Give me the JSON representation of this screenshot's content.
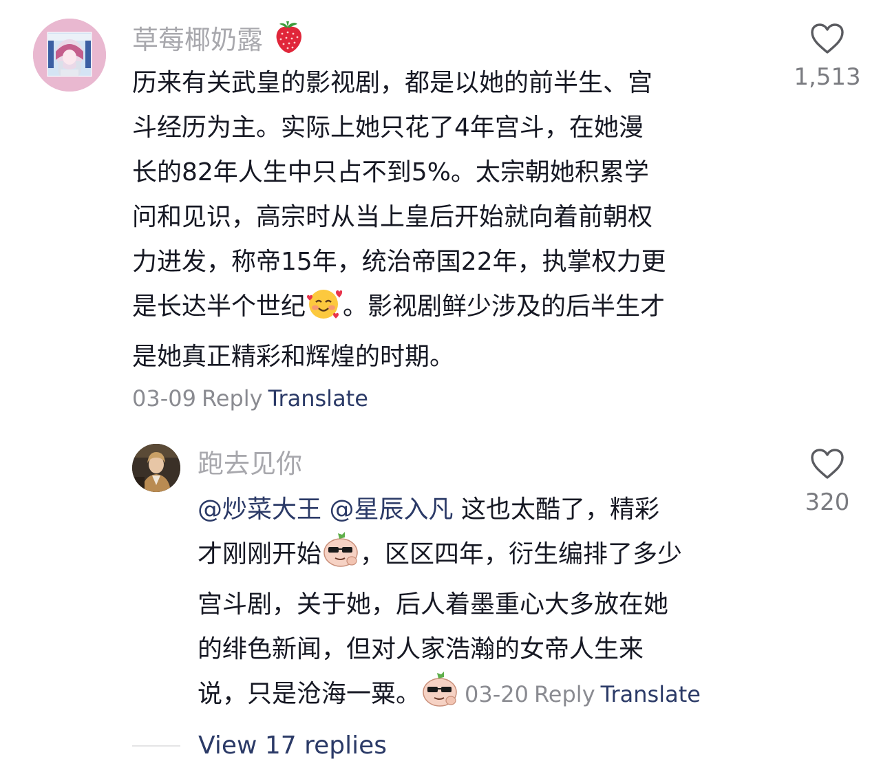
{
  "comments": [
    {
      "username": "草莓椰奶露",
      "username_emoji": "strawberry-emoji",
      "lines": [
        "历来有关武皇的影视剧，都是以她的前半生、宫",
        "斗经历为主。实际上她只花了4年宫斗，在她漫",
        "长的82年人生中只占不到5%。太宗朝她积累学",
        "问和见识，高宗时从当上皇后开始就向着前朝权",
        "力进发，称帝15年，统治帝国22年，执掌权力更",
        "是长达半个世纪",
        "。影视剧鲜少涉及的后半生才",
        "是她真正精彩和辉煌的时期。"
      ],
      "date": "03-09",
      "reply_label": "Reply",
      "translate_label": "Translate",
      "like_count": "1,513",
      "like_icon": "heart-outline-icon"
    },
    {
      "username": "跑去见你",
      "mention_1": "@炒菜大王",
      "mention_2": "@星辰入凡",
      "lines": [
        "这也太酷了，精彩",
        "才刚刚开始",
        "，区区四年，衍生编排了多少",
        "宫斗剧，关于她，后人着墨重心大多放在她",
        "的绯色新闻，但对人家浩瀚的女帝人生来",
        "说，只是沧海一粟。"
      ],
      "date": "03-20",
      "reply_label": "Reply",
      "translate_label": "Translate",
      "like_count": "320",
      "like_icon": "heart-outline-icon"
    }
  ],
  "view_replies_label": "View 17 replies",
  "colors": {
    "text": "#161823",
    "username": "#a8a8ad",
    "meta": "#8a8b91",
    "link": "#2b3a67",
    "like_count": "#7a7b80"
  }
}
